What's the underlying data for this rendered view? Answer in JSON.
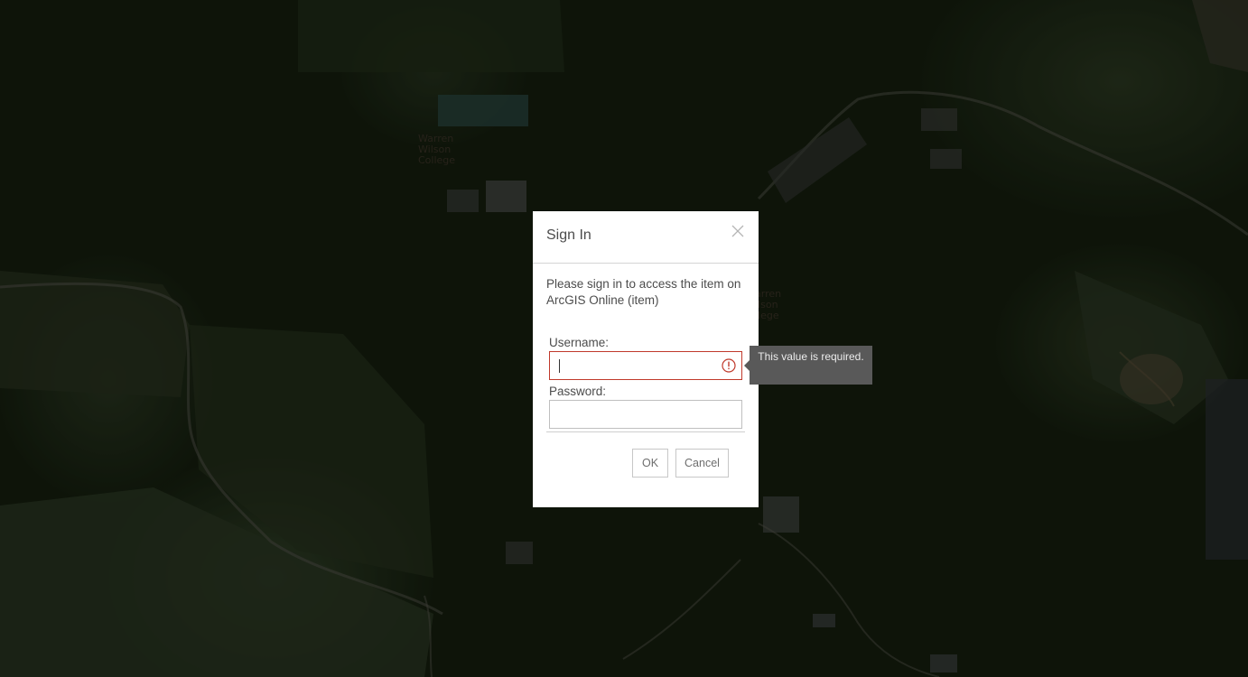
{
  "map": {
    "labels": [
      {
        "name": "map-label-warren-wilson-college-1",
        "text": "Warren\nWilson\nCollege"
      },
      {
        "name": "map-label-warren-wilson-college-2",
        "text": "arren\nilson\nllege"
      }
    ]
  },
  "dialog": {
    "title": "Sign In",
    "close_icon": "close-icon",
    "message": "Please sign in to access the item on ArcGIS Online (item)",
    "username_label": "Username:",
    "username_value": "",
    "password_label": "Password:",
    "password_value": "",
    "ok_label": "OK",
    "cancel_label": "Cancel",
    "error_color": "#c0392b",
    "alert_icon": "alert-circle-icon"
  },
  "tooltip": {
    "text": "This value is required."
  }
}
